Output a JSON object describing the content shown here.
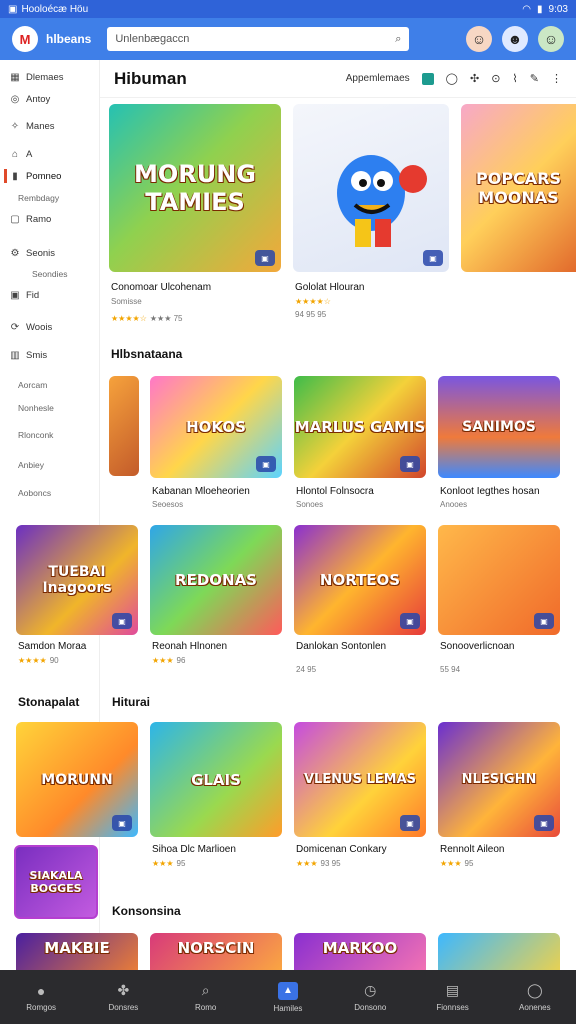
{
  "status": {
    "left": "Hooloécæ Höu",
    "right": "9:03"
  },
  "header": {
    "app_name": "hlbeans",
    "search_placeholder": "Unlenbægaccn",
    "logo": "M"
  },
  "sidebar": {
    "items": [
      {
        "label": "Dlemaes",
        "icon": "grid-icon"
      },
      {
        "label": "Antoy",
        "icon": "circle-icon"
      },
      {
        "label": "Manes",
        "icon": "sparkle-icon"
      },
      {
        "label": "A",
        "icon": "hat-icon"
      },
      {
        "label": "Pomneo",
        "icon": "bar-icon"
      },
      {
        "label": "Ramo",
        "icon": "square-icon"
      },
      {
        "label": "Seonis",
        "icon": "gear-icon"
      },
      {
        "label": "Fid",
        "icon": "box-icon"
      },
      {
        "label": "Woois",
        "icon": "sync-icon"
      },
      {
        "label": "Smis",
        "icon": "grid-icon"
      }
    ],
    "subs": [
      "Rembdagy",
      "Seondies",
      "Aorcam",
      "Nonhesle",
      "Rlonconk",
      "Anbiey",
      "Aoboncs"
    ]
  },
  "page": {
    "title": "Hibuman",
    "appearance_label": "Appemlemaes"
  },
  "sections": {
    "s1": "Hlbsnataana",
    "s2a": "Stonapalat",
    "s2b": "Hiturai",
    "s3": "Konsonsina"
  },
  "cards": {
    "c1": {
      "title": "Conomoar Ulcohenam",
      "sub": "Somisse",
      "stars": "★★★★☆",
      "rating": "★★★ 75",
      "art": "MORUNG TAMIES"
    },
    "c2": {
      "title": "Gololat Hlouran",
      "stars": "★★★★☆",
      "rating": "94 95 95",
      "art": ""
    },
    "c3": {
      "art": "POPCARS MOONAS"
    },
    "c4": {
      "title": "Kabanan Mloeheorien",
      "sub": "Seoesos",
      "art": "HOKOS"
    },
    "c5": {
      "title": "Hlontol Folnsocra",
      "sub": "Sonoes",
      "art": "MARLUS GAMIS"
    },
    "c6": {
      "title": "Konloot Iegthes hosan",
      "sub": "Anooes",
      "art": "SANIMOS"
    },
    "c7": {
      "title": "Samdon Moraa",
      "stars": "★★★★",
      "rating": "90",
      "art": "TUEBAI Inagoors"
    },
    "c8": {
      "title": "Reonah Hlnonen",
      "stars": "★★★",
      "rating": "96",
      "art": "REDONAS"
    },
    "c9": {
      "title": "Danlokan Sontonlen",
      "rating": "24 95",
      "art": "NORTEOS"
    },
    "c10": {
      "title": "Sonooverlicnoan",
      "rating": "55 94",
      "art": ""
    },
    "c11": {
      "art": "MORUNN"
    },
    "c12": {
      "title": "Sihoa Dlc Marlioen",
      "stars": "★★★",
      "rating": "95",
      "art": "GLAIS"
    },
    "c13": {
      "title": "Domicenan Conkary",
      "stars": "★★★",
      "rating": "93 95",
      "art": "VLENUS LEMAS"
    },
    "c14": {
      "title": "Rennolt Aileon",
      "stars": "★★★",
      "rating": "95",
      "art": "NLESIGHN"
    },
    "c15": {
      "art": "SIAKALA BOGGES"
    },
    "c16": {
      "art": "MAKBIE"
    },
    "c17": {
      "art": "NORSCIN"
    },
    "c18": {
      "art": "MARKOO"
    },
    "c19": {
      "art": ""
    }
  },
  "bottom_nav": [
    {
      "label": "Romgos",
      "icon": "bulb-icon"
    },
    {
      "label": "Donsres",
      "icon": "puzzle-icon"
    },
    {
      "label": "Romo",
      "icon": "search-icon"
    },
    {
      "label": "Hamiles",
      "icon": "home-icon"
    },
    {
      "label": "Donsono",
      "icon": "clock-icon"
    },
    {
      "label": "Fionnses",
      "icon": "store-icon"
    },
    {
      "label": "Aonenes",
      "icon": "person-icon"
    }
  ],
  "colors": {
    "accent": "#3f7fe8",
    "status_bar": "#2f63d8",
    "bottom_nav": "#2b2b2e",
    "star": "#f2a400"
  }
}
